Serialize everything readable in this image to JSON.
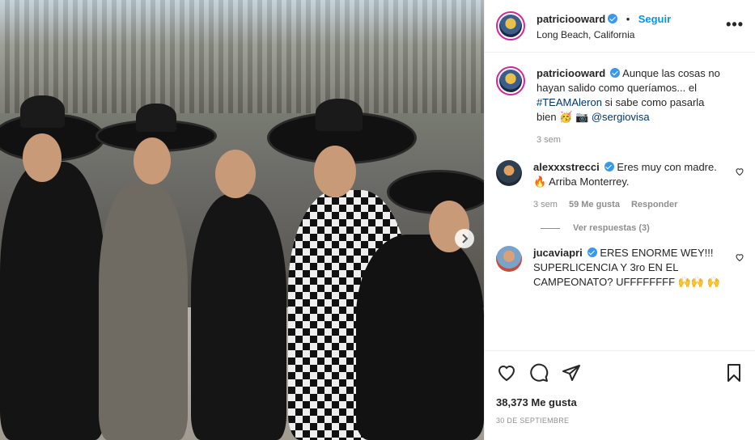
{
  "post": {
    "username": "patriciooward",
    "follow_label": "Seguir",
    "separator": "•",
    "location": "Long Beach, California",
    "more_label": "•••"
  },
  "caption": {
    "username": "patriciooward",
    "text_before": "Aunque las cosas no hayan salido como queríamos... el",
    "hashtag": "#TEAMAleron",
    "text_after": "si sabe como pasarla bien",
    "emojis": "🥳 📷",
    "mention": "@sergiovisa",
    "time": "3 sem"
  },
  "comments": [
    {
      "username": "alexxxstrecci",
      "text": "Eres muy con madre. 🔥 Arriba Monterrey.",
      "time": "3 sem",
      "likes": "59 Me gusta",
      "reply_label": "Responder",
      "view_replies": "Ver respuestas (3)"
    },
    {
      "username": "jucaviapri",
      "text": "ERES ENORME WEY!!! SUPERLICENCIA Y 3ro EN EL CAMPEONATO? UFFFFFFFF 🙌🙌 🙌"
    }
  ],
  "footer": {
    "likes": "38,373 Me gusta",
    "date": "30 DE SEPTIEMBRE"
  },
  "icons": {
    "like": "heart-icon",
    "comment": "comment-icon",
    "share": "share-icon",
    "save": "bookmark-icon",
    "next": "chevron-right-icon"
  },
  "colors": {
    "accent": "#0095f6",
    "verified": "#3897f0",
    "muted": "#8e8e8e",
    "link": "#00376b"
  }
}
